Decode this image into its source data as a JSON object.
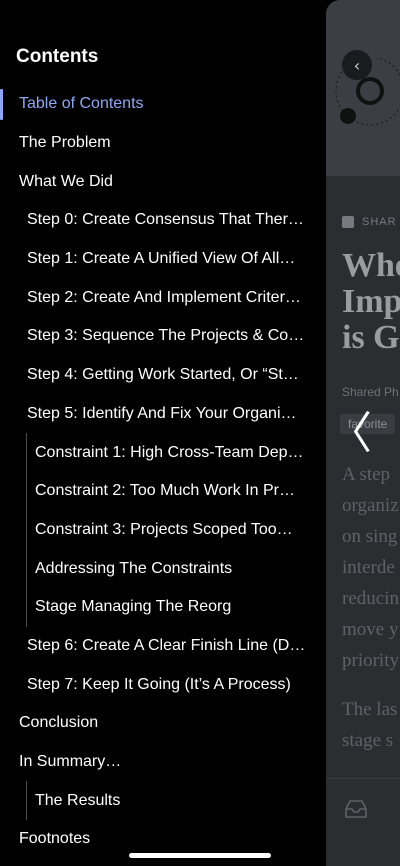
{
  "contents_panel": {
    "title": "Contents",
    "items": [
      {
        "label": "Table of Contents",
        "level": 0,
        "active": true
      },
      {
        "label": "The Problem",
        "level": 0
      },
      {
        "label": "What We Did",
        "level": 0
      },
      {
        "label": "Step 0: Create Consensus That Ther…",
        "level": 1
      },
      {
        "label": "Step 1: Create A Unified View Of All…",
        "level": 1
      },
      {
        "label": "Step 2: Create And Implement Criter…",
        "level": 1
      },
      {
        "label": "Step 3: Sequence The Projects & Co…",
        "level": 1
      },
      {
        "label": "Step 4: Getting Work Started, Or “St…",
        "level": 1
      },
      {
        "label": "Step 5: Identify And Fix Your Organi…",
        "level": 1
      },
      {
        "label": "Constraint 1: High Cross-Team Dep…",
        "level": 2
      },
      {
        "label": "Constraint 2: Too Much Work In Pr…",
        "level": 2
      },
      {
        "label": "Constraint 3: Projects Scoped Too…",
        "level": 2
      },
      {
        "label": "Addressing The Constraints",
        "level": 2
      },
      {
        "label": "Stage Managing The Reorg",
        "level": 2
      },
      {
        "label": "Step 6: Create A Clear Finish Line (D…",
        "level": 1
      },
      {
        "label": "Step 7: Keep It Going (It’s A Process)",
        "level": 1
      },
      {
        "label": "Conclusion",
        "level": 0
      },
      {
        "label": "In Summary…",
        "level": 0
      },
      {
        "label": "The Results",
        "level": 2
      },
      {
        "label": "Footnotes",
        "level": 0
      }
    ]
  },
  "reader_peek": {
    "share_label": "SHAR",
    "title": "Whe\nImp\nis G",
    "byline": "Shared Ph",
    "tag": "favorite",
    "body1": "A step\norganiz\non sing\ninterde\nreducin\nmove y\npriority",
    "body2": "The las\nstage s"
  },
  "colors": {
    "accent": "#8da7f5",
    "panel_bg": "#000000",
    "reader_bg": "#2b2d31"
  },
  "icons": {
    "back": "chevron-left-icon",
    "grab": "chevron-left-icon",
    "inbox": "inbox-icon"
  }
}
